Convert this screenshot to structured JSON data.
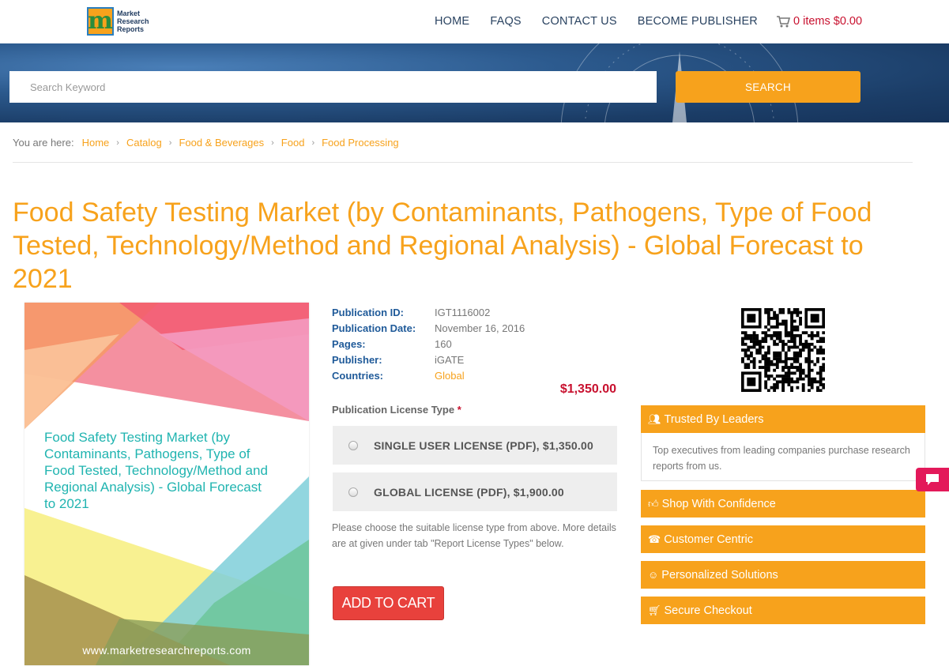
{
  "header": {
    "logo": {
      "line1": "Market",
      "line2": "Research",
      "line3": "Reports",
      "mark": "m"
    },
    "nav": [
      {
        "label": "HOME"
      },
      {
        "label": "FAQS"
      },
      {
        "label": "CONTACT US"
      },
      {
        "label": "BECOME PUBLISHER"
      }
    ],
    "cart": {
      "label": "0 items $0.00",
      "icon": "cart-icon"
    }
  },
  "search": {
    "placeholder": "Search Keyword",
    "value": "",
    "button_label": "SEARCH"
  },
  "breadcrumb": {
    "lead": "You are here:",
    "items": [
      "Home",
      "Catalog",
      "Food & Beverages",
      "Food",
      "Food Processing"
    ]
  },
  "product": {
    "title": "Food Safety Testing Market (by Contaminants, Pathogens, Type of Food Tested, Technology/Method and Regional Analysis) - Global Forecast to 2021",
    "cover_title": "Food Safety Testing Market (by Contaminants, Pathogens, Type of Food Tested, Technology/Method and Regional Analysis) - Global Forecast to 2021",
    "cover_url": "www.marketresearchreports.com",
    "meta": [
      {
        "key": "Publication ID:",
        "value": "IGT1116002"
      },
      {
        "key": "Publication Date:",
        "value": "November 16, 2016"
      },
      {
        "key": "Pages:",
        "value": "160"
      },
      {
        "key": "Publisher:",
        "value": "iGATE"
      },
      {
        "key": "Countries:",
        "value": "Global"
      }
    ],
    "price": "$1,350.00",
    "license_label": "Publication License Type",
    "license_required_mark": "*",
    "licenses": [
      {
        "label": "SINGLE USER LICENSE (PDF), $1,350.00",
        "selected": false
      },
      {
        "label": "GLOBAL LICENSE (PDF), $1,900.00",
        "selected": false
      }
    ],
    "license_note": "Please choose the suitable license type from above. More details are at given under tab \"Report License Types\" below.",
    "add_to_cart": "ADD TO CART"
  },
  "sidebar": {
    "trusted": {
      "title": "Trusted By Leaders",
      "icon": "users-icon",
      "body": "Top executives from leading companies purchase research reports from us."
    },
    "items": [
      {
        "title": "Shop With Confidence",
        "icon": "thumbs-up-icon"
      },
      {
        "title": "Customer Centric",
        "icon": "phone-icon"
      },
      {
        "title": "Personalized Solutions",
        "icon": "smile-icon"
      },
      {
        "title": "Secure Checkout",
        "icon": "cart-icon"
      }
    ]
  },
  "colors": {
    "accent": "#f7a21c",
    "price": "#c8102e",
    "meta_key": "#1f5a99",
    "add_cart": "#e8413c",
    "banner": "#1b3d67"
  }
}
